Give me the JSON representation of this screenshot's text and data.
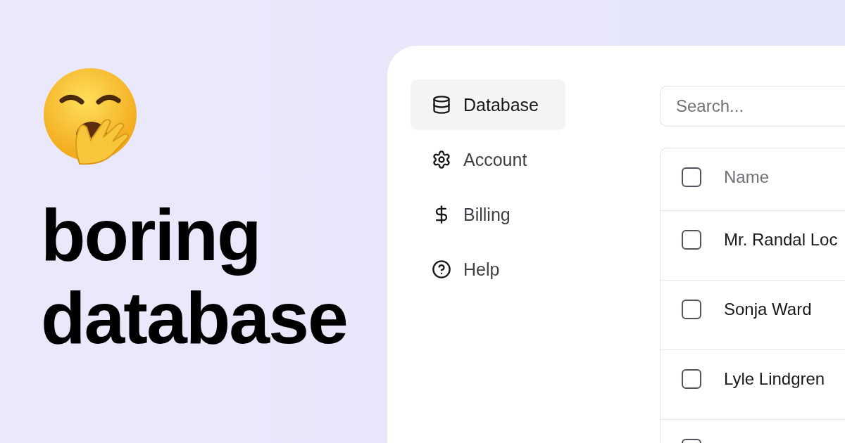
{
  "headline": "boring database",
  "sidebar": {
    "items": [
      {
        "kind": "database",
        "label": "Database",
        "selected": true
      },
      {
        "kind": "settings",
        "label": "Account",
        "selected": false
      },
      {
        "kind": "billing",
        "label": "Billing",
        "selected": false
      },
      {
        "kind": "help",
        "label": "Help",
        "selected": false
      }
    ]
  },
  "search": {
    "placeholder": "Search..."
  },
  "table": {
    "header": {
      "label": "Name",
      "checked": false
    },
    "rows": [
      {
        "name": "Mr. Randal Loc",
        "checked": false
      },
      {
        "name": "Sonja Ward",
        "checked": false
      },
      {
        "name": "Lyle Lindgren",
        "checked": false
      },
      {
        "checked": false
      }
    ]
  }
}
